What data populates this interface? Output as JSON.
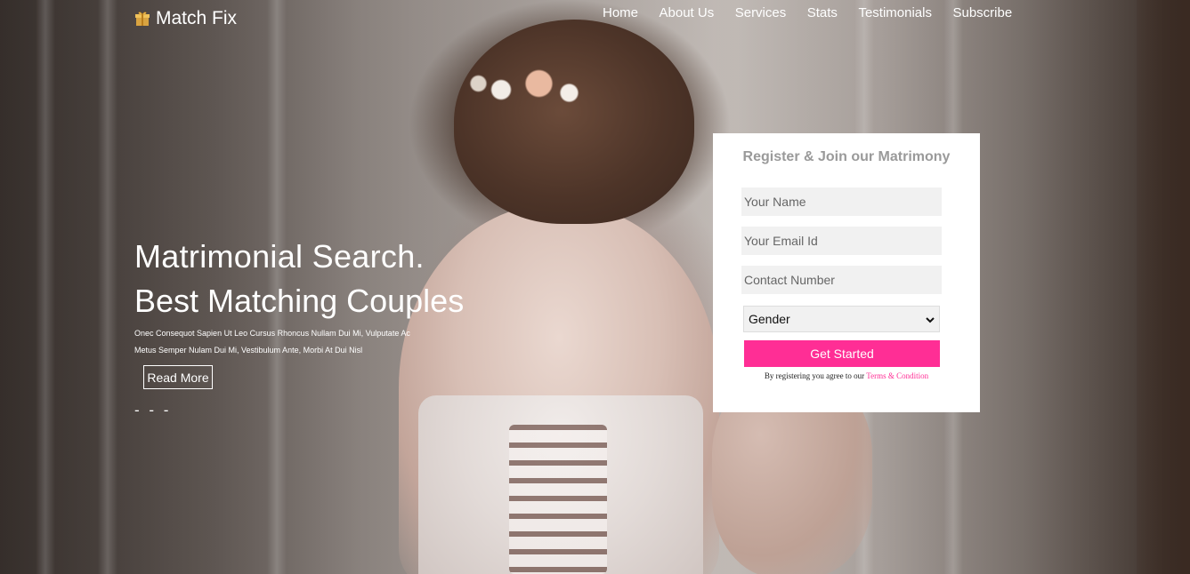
{
  "brand": {
    "name": "Match Fix",
    "icon": "gift-icon"
  },
  "nav": [
    {
      "label": "Home"
    },
    {
      "label": "About Us"
    },
    {
      "label": "Services"
    },
    {
      "label": "Stats"
    },
    {
      "label": "Testimonials"
    },
    {
      "label": "Subscribe"
    }
  ],
  "hero": {
    "title": "Matrimonial Search.",
    "subtitle": "Best Matching Couples",
    "desc_line1": "Onec Consequot Sapien Ut Leo Cursus Rhoncus Nullam Dui Mi, Vulputate Ac",
    "desc_line2": "Metus Semper Nulam Dui Mi, Vestibulum Ante, Morbi At Dui Nisl",
    "read_more": "Read More",
    "slider_indicator": "- - -"
  },
  "form": {
    "title": "Register & Join our Matrimony",
    "name_placeholder": "Your Name",
    "email_placeholder": "Your Email Id",
    "contact_placeholder": "Contact Number",
    "gender_selected": "Gender",
    "submit_label": "Get Started",
    "terms_text": "By registering you agree to our ",
    "terms_link": "Terms & Condition"
  },
  "colors": {
    "accent": "#ff2e95",
    "card_title": "#9a9a9a",
    "field_bg": "#f1f1f1"
  }
}
